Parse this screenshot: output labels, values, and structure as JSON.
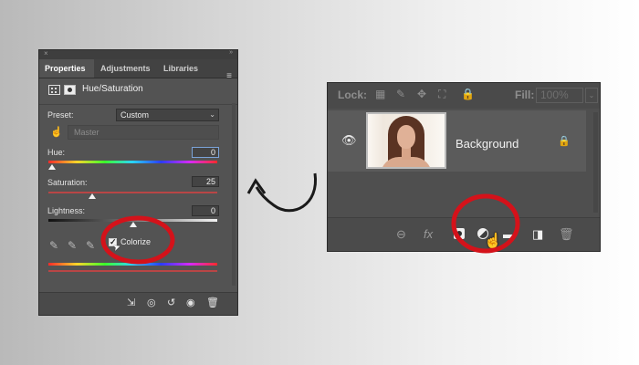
{
  "properties_panel": {
    "tabs": [
      "Properties",
      "Adjustments",
      "Libraries"
    ],
    "title": "Hue/Saturation",
    "preset_label": "Preset:",
    "preset_value": "Custom",
    "channel_value": "Master",
    "hue_label": "Hue:",
    "hue_value": "0",
    "saturation_label": "Saturation:",
    "saturation_value": "25",
    "lightness_label": "Lightness:",
    "lightness_value": "0",
    "colorize_label": "Colorize",
    "colorize_checked": "✓"
  },
  "layers_panel": {
    "lock_label": "Lock:",
    "fill_label": "Fill:",
    "fill_value": "100%",
    "layer_name": "Background"
  },
  "icons": {
    "lock_pixels": "▦",
    "lock_brush": "✎",
    "lock_move": "✥",
    "lock_artboard": "⛶",
    "lock_all": "🔒",
    "layer_lock": "🔒",
    "eye": "👁",
    "link": "⊖",
    "fx": "fx",
    "new_group": "▬",
    "new_layer": "◨",
    "trash": "🗑"
  },
  "colors": {
    "annotation_red": "#d4121a",
    "panel_bg": "#535353"
  }
}
